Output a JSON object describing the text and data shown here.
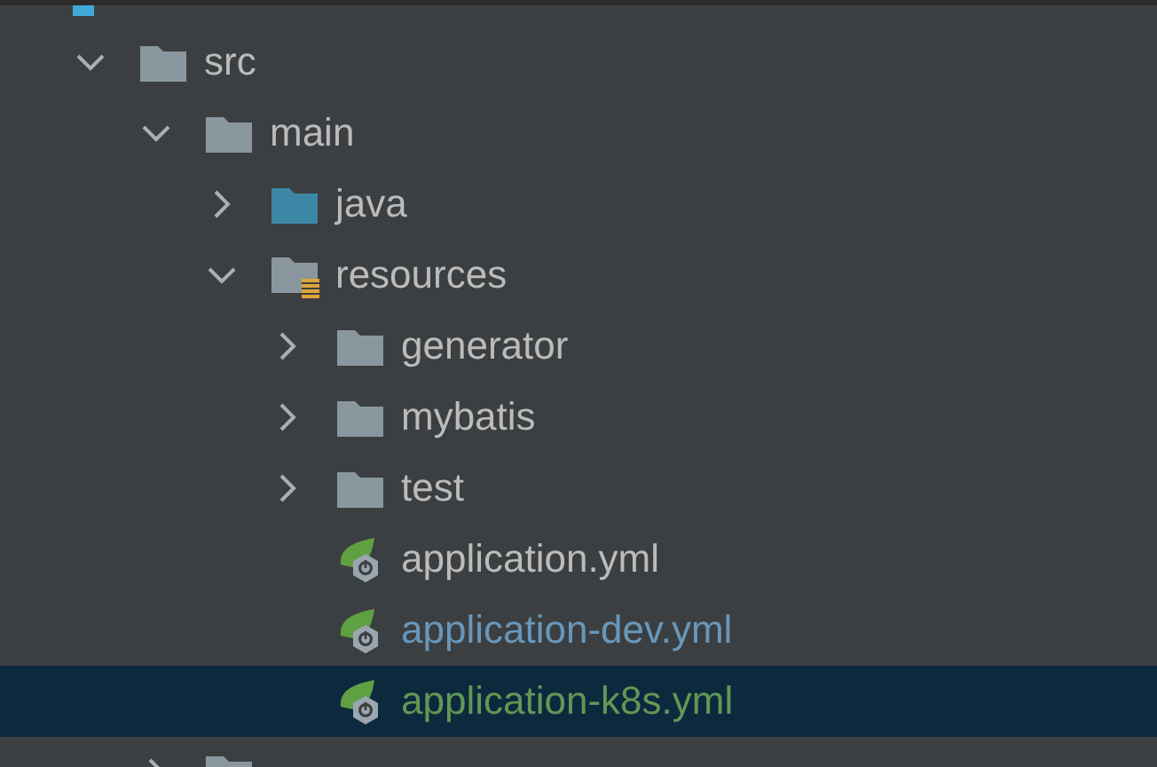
{
  "project_tree": [
    {
      "kind": "module",
      "selected": false,
      "children": [
        {
          "kind": "folder",
          "name": "src",
          "expanded": true,
          "selected": false,
          "modified": false,
          "added": false,
          "children": [
            {
              "kind": "folder",
              "name": "main",
              "expanded": true,
              "selected": false,
              "modified": false,
              "added": false,
              "children": [
                {
                  "kind": "source-folder",
                  "name": "java",
                  "expanded": false,
                  "selected": false,
                  "modified": false,
                  "added": false
                },
                {
                  "kind": "resource-folder",
                  "name": "resources",
                  "expanded": true,
                  "selected": false,
                  "modified": false,
                  "added": false,
                  "children": [
                    {
                      "kind": "folder",
                      "name": "generator",
                      "expanded": false,
                      "selected": false,
                      "modified": false,
                      "added": false
                    },
                    {
                      "kind": "folder",
                      "name": "mybatis",
                      "expanded": false,
                      "selected": false,
                      "modified": false,
                      "added": false
                    },
                    {
                      "kind": "folder",
                      "name": "test",
                      "expanded": false,
                      "selected": false,
                      "modified": false,
                      "added": false
                    },
                    {
                      "kind": "spring-file",
                      "name": "application.yml",
                      "selected": false,
                      "modified": false,
                      "added": false
                    },
                    {
                      "kind": "spring-file",
                      "name": "application-dev.yml",
                      "selected": false,
                      "modified": true,
                      "added": false
                    },
                    {
                      "kind": "spring-file",
                      "name": "application-k8s.yml",
                      "selected": true,
                      "modified": false,
                      "added": true
                    }
                  ]
                }
              ]
            },
            {
              "kind": "folder",
              "expanded": false,
              "selected": false
            }
          ]
        }
      ]
    }
  ]
}
